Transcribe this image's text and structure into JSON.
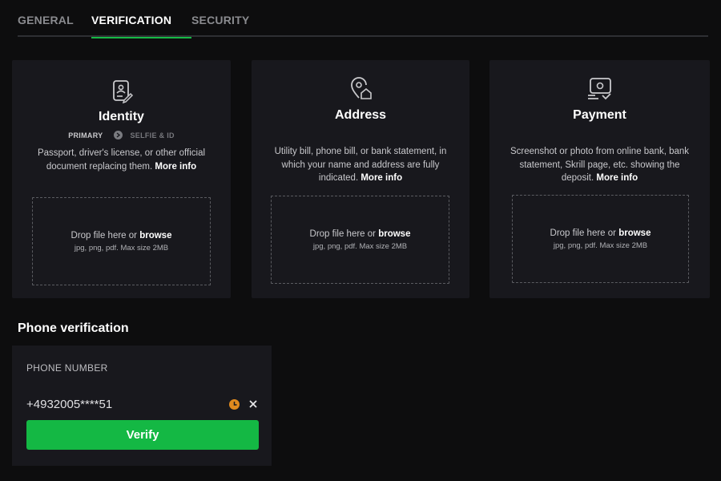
{
  "tabs": [
    {
      "label": "GENERAL",
      "active": false
    },
    {
      "label": "VERIFICATION",
      "active": true
    },
    {
      "label": "SECURITY",
      "active": false
    }
  ],
  "colors": {
    "accent": "#16b845",
    "pending": "#e08a1e",
    "card_bg": "#18181d",
    "page_bg": "#0d0d0e"
  },
  "cards": [
    {
      "icon": "id-document-icon",
      "title": "Identity",
      "tags": {
        "primary": "PRIMARY",
        "secondary": "SELFIE & ID"
      },
      "description": "Passport, driver's license, or other official document replacing them.",
      "more_info": "More info",
      "drop_text": "Drop file here or",
      "browse": "browse",
      "formats": "jpg, png, pdf. Max size 2MB"
    },
    {
      "icon": "map-pin-home-icon",
      "title": "Address",
      "description": "Utility bill, phone bill, or bank statement, in which your name and address are fully indicated.",
      "more_info": "More info",
      "drop_text": "Drop file here or",
      "browse": "browse",
      "formats": "jpg, png, pdf. Max size 2MB"
    },
    {
      "icon": "payment-card-icon",
      "title": "Payment",
      "description": "Screenshot or photo from online bank, bank statement, Skrill page, etc. showing the deposit.",
      "more_info": "More info",
      "drop_text": "Drop file here or",
      "browse": "browse",
      "formats": "jpg, png, pdf. Max size 2MB"
    }
  ],
  "phone": {
    "heading": "Phone verification",
    "label": "PHONE NUMBER",
    "value": "+4932005****51",
    "status_icon": "clock-pending-icon",
    "clear_icon": "close-icon",
    "verify_label": "Verify"
  }
}
